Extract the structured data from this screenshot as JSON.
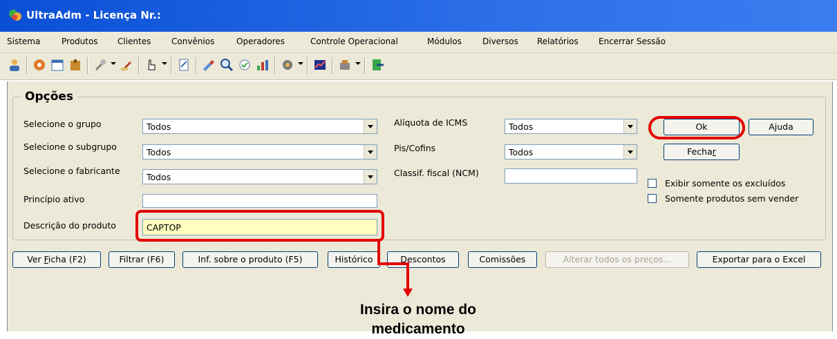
{
  "window": {
    "title": "UltraAdm - Licença Nr.:"
  },
  "menu": [
    "Sistema",
    "Produtos",
    "Clientes",
    "Convênios",
    "Operadores",
    "Controle Operacional",
    "Módulos",
    "Diversos",
    "Relatórios",
    "Encerrar Sessão"
  ],
  "options": {
    "title": "Opções",
    "group_label": "Selecione o grupo",
    "group_value": "Todos",
    "subgroup_label": "Selecione o subgrupo",
    "subgroup_value": "Todos",
    "manufacturer_label": "Selecione o fabricante",
    "manufacturer_value": "Todos",
    "active_label": "Princípio ativo",
    "active_value": "",
    "description_label": "Descrição do produto",
    "description_value": "CAPTOP",
    "icms_label": "Alíquota de ICMS",
    "icms_value": "Todos",
    "pis_label": "Pis/Cofins",
    "pis_value": "Todos",
    "ncm_label": "Classif. fiscal (NCM)",
    "ncm_value": "",
    "ok_label": "Ok",
    "help_label": "Ajuda",
    "close_label_a": "Fecha",
    "close_label_b": "r",
    "excluded_label": "Exibir somente os excluídos",
    "unsold_label": "Somente produtos sem vender"
  },
  "actions": {
    "view_a": "Ver ",
    "view_b": "F",
    "view_c": "icha (F2)",
    "filter": "Filtrar (F6)",
    "info": "Inf. sobre o produto (F5)",
    "history": "Histórico",
    "discounts_a": "",
    "discounts_b": "D",
    "discounts_c": "escontos",
    "commissions": "Comissões",
    "change_prices": "Alterar todos os preços...",
    "export": "Exportar para o Excel"
  },
  "annotation": {
    "line1": "Insira o nome do",
    "line2": "medicamento"
  },
  "colors": {
    "highlight": "#e50000",
    "title_bar": "#0a4fd6",
    "field_highlight": "#ffffc0"
  }
}
